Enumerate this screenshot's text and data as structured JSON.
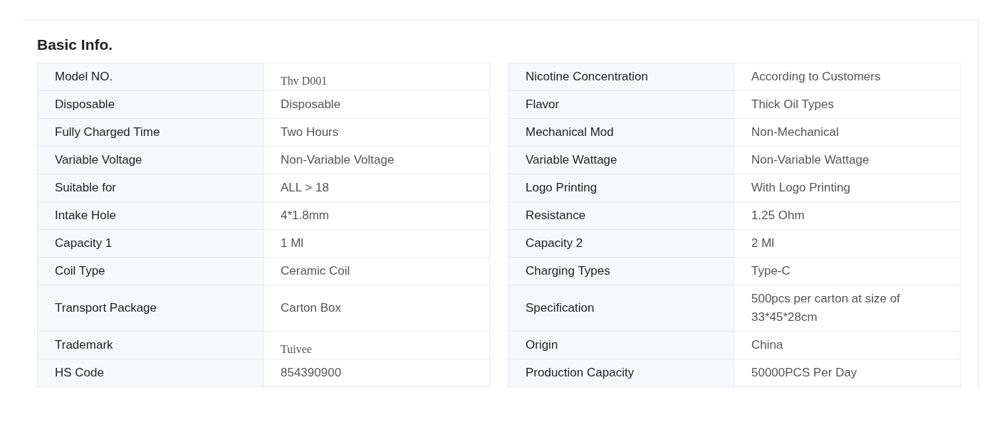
{
  "section": {
    "title": "Basic Info."
  },
  "left_table": {
    "rows": [
      {
        "label": "Model NO.",
        "value": "Thv D001",
        "kind": "serif"
      },
      {
        "label": "Disposable",
        "value": "Disposable",
        "kind": "plain"
      },
      {
        "label": "Fully Charged Time",
        "value": "Two Hours",
        "kind": "plain"
      },
      {
        "label": "Variable Voltage",
        "value": "Non-Variable Voltage",
        "kind": "plain"
      },
      {
        "label": "Suitable for",
        "value": "ALL > 18",
        "kind": "plain"
      },
      {
        "label": "Intake Hole",
        "value": "4*1.8mm",
        "kind": "plain"
      },
      {
        "label": "Capacity 1",
        "value": "1 Ml",
        "kind": "plain"
      },
      {
        "label": "Coil Type",
        "value": "Ceramic Coil",
        "kind": "plain"
      },
      {
        "label": "Transport Package",
        "value": "Carton Box",
        "kind": "plain"
      },
      {
        "label": "Trademark",
        "value": "Tuivee",
        "kind": "serif"
      },
      {
        "label": "HS Code",
        "value": "854390900",
        "kind": "plain"
      }
    ]
  },
  "right_table": {
    "rows": [
      {
        "label": "Nicotine Concentration",
        "value": "According to Customers",
        "kind": "plain"
      },
      {
        "label": "Flavor",
        "value": "Thick Oil Types",
        "kind": "plain"
      },
      {
        "label": "Mechanical Mod",
        "value": "Non-Mechanical",
        "kind": "plain"
      },
      {
        "label": "Variable Wattage",
        "value": "Non-Variable Wattage",
        "kind": "plain"
      },
      {
        "label": "Logo Printing",
        "value": "With Logo Printing",
        "kind": "plain"
      },
      {
        "label": "Resistance",
        "value": "1.25 Ohm",
        "kind": "plain"
      },
      {
        "label": "Capacity 2",
        "value": "2 Ml",
        "kind": "plain"
      },
      {
        "label": "Charging Types",
        "value": "Type-C",
        "kind": "plain"
      },
      {
        "label": "Specification",
        "value": "500pcs per carton at size of 33*45*28cm",
        "kind": "plain"
      },
      {
        "label": "Origin",
        "value": "China",
        "kind": "plain"
      },
      {
        "label": "Production Capacity",
        "value": "50000PCS Per Day",
        "kind": "plain"
      }
    ]
  }
}
